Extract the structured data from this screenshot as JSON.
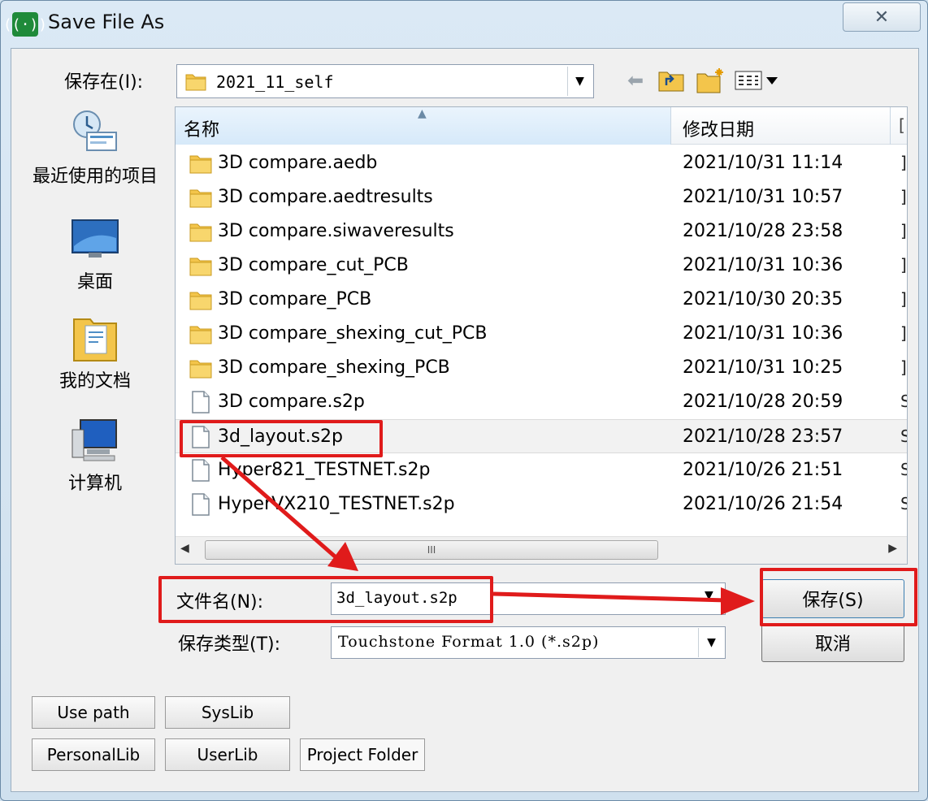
{
  "window": {
    "title": "Save File As",
    "close_glyph": "✕",
    "app_icon": "signal-icon"
  },
  "toolbar": {
    "save_in_label": "保存在(I):",
    "save_in_value": "2021_11_self",
    "icons": [
      "back-arrow-icon",
      "up-one-level-icon",
      "new-folder-icon",
      "view-menu-icon"
    ]
  },
  "places": [
    {
      "label": "最近使用的项目",
      "icon": "recent-items-icon"
    },
    {
      "label": "桌面",
      "icon": "desktop-icon"
    },
    {
      "label": "我的文档",
      "icon": "my-documents-icon"
    },
    {
      "label": "计算机",
      "icon": "computer-icon"
    }
  ],
  "file_list": {
    "columns": {
      "name": "名称",
      "date": "修改日期",
      "more": "["
    },
    "sort_indicator": "▲",
    "rows": [
      {
        "name": "3D compare.aedb",
        "date": "2021/10/31 11:14",
        "type": "folder",
        "clip": "]"
      },
      {
        "name": "3D compare.aedtresults",
        "date": "2021/10/31 10:57",
        "type": "folder",
        "clip": "]"
      },
      {
        "name": "3D compare.siwaveresults",
        "date": "2021/10/28 23:58",
        "type": "folder",
        "clip": "]"
      },
      {
        "name": "3D compare_cut_PCB",
        "date": "2021/10/31 10:36",
        "type": "folder",
        "clip": "]"
      },
      {
        "name": "3D compare_PCB",
        "date": "2021/10/30 20:35",
        "type": "folder",
        "clip": "]"
      },
      {
        "name": "3D compare_shexing_cut_PCB",
        "date": "2021/10/31 10:36",
        "type": "folder",
        "clip": "]"
      },
      {
        "name": "3D compare_shexing_PCB",
        "date": "2021/10/31 10:25",
        "type": "folder",
        "clip": "]"
      },
      {
        "name": "3D compare.s2p",
        "date": "2021/10/28 20:59",
        "type": "file",
        "clip": "S"
      },
      {
        "name": "3d_layout.s2p",
        "date": "2021/10/28 23:57",
        "type": "file",
        "clip": "S",
        "selected": true
      },
      {
        "name": "Hyper821_TESTNET.s2p",
        "date": "2021/10/26 21:51",
        "type": "file",
        "clip": "S"
      },
      {
        "name": "HyperVX210_TESTNET.s2p",
        "date": "2021/10/26 21:54",
        "type": "file",
        "clip": "S"
      }
    ],
    "scroll_thumb_grip": "III",
    "scroll_left": "◀",
    "scroll_right": "▶"
  },
  "form": {
    "filename_label": "文件名(N):",
    "filename_value": "3d_layout.s2p",
    "filetype_label": "保存类型(T):",
    "filetype_value": "Touchstone Format 1.0 (*.s2p)",
    "dropdown_glyph": "▼"
  },
  "buttons": {
    "save": "保存(S)",
    "cancel": "取消"
  },
  "lib_buttons": {
    "use_path": "Use path",
    "syslib": "SysLib",
    "personallib": "PersonalLib",
    "userlib": "UserLib",
    "project_folder": "Project Folder"
  },
  "annotation_color": "#e01b1b"
}
